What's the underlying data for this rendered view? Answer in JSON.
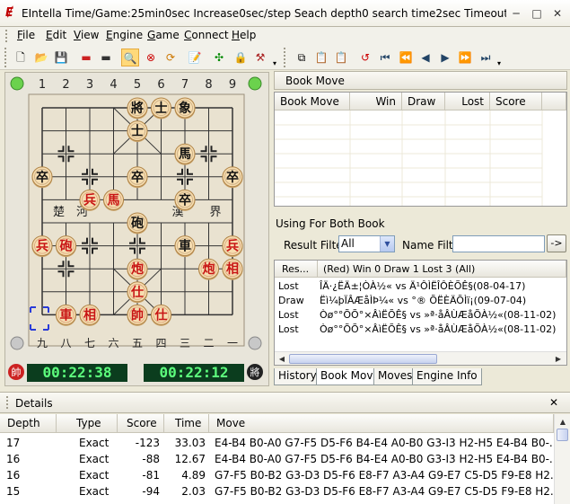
{
  "window": {
    "title": "EIntella Time/Game:25min0sec Increase0sec/step Seach depth0 search time2sec Timeout ...",
    "min": "─",
    "max": "□",
    "close": "✕"
  },
  "menu": [
    {
      "accel": "F",
      "rest": "ile"
    },
    {
      "accel": "E",
      "rest": "dit"
    },
    {
      "accel": "V",
      "rest": "iew"
    },
    {
      "accel": "E",
      "rest": "ngine"
    },
    {
      "accel": "G",
      "rest": "ame"
    },
    {
      "accel": "C",
      "rest": "onnect"
    },
    {
      "accel": "H",
      "rest": "elp"
    }
  ],
  "toolbar_icons": [
    "new-icon",
    "open-icon",
    "save-icon",
    "board-red-icon",
    "board-black-icon",
    "search-icon",
    "stop-icon",
    "refresh-icon",
    "edit-icon",
    "engine-icon",
    "lock-icon",
    "hammer-icon",
    "copy-icon",
    "paste-icon",
    "paste-board-icon",
    "undo-icon",
    "first-icon",
    "prev-fast-icon",
    "prev-icon",
    "next-icon",
    "next-fast-icon",
    "last-icon"
  ],
  "board": {
    "top_files": [
      "1",
      "2",
      "3",
      "4",
      "5",
      "6",
      "7",
      "8",
      "9"
    ],
    "bottom_files": [
      "九",
      "八",
      "七",
      "六",
      "五",
      "四",
      "三",
      "二",
      "一"
    ],
    "river_left": [
      "楚",
      "河"
    ],
    "river_right": [
      "漢",
      "界"
    ],
    "black_pieces": [
      {
        "c": "將",
        "f": 4,
        "r": 0
      },
      {
        "c": "士",
        "f": 5,
        "r": 0
      },
      {
        "c": "象",
        "f": 6,
        "r": 0
      },
      {
        "c": "士",
        "f": 4,
        "r": 1
      },
      {
        "c": "馬",
        "f": 6,
        "r": 2
      },
      {
        "c": "卒",
        "f": 0,
        "r": 3
      },
      {
        "c": "卒",
        "f": 4,
        "r": 3
      },
      {
        "c": "卒",
        "f": 8,
        "r": 3
      },
      {
        "c": "卒",
        "f": 6,
        "r": 4
      },
      {
        "c": "砲",
        "f": 4,
        "r": 5
      },
      {
        "c": "車",
        "f": 6,
        "r": 6
      }
    ],
    "red_pieces": [
      {
        "c": "兵",
        "f": 2,
        "r": 4
      },
      {
        "c": "馬",
        "f": 3,
        "r": 4
      },
      {
        "c": "兵",
        "f": 0,
        "r": 6
      },
      {
        "c": "砲",
        "f": 1,
        "r": 6
      },
      {
        "c": "兵",
        "f": 8,
        "r": 6
      },
      {
        "c": "炮",
        "f": 4,
        "r": 7
      },
      {
        "c": "炮",
        "f": 7,
        "r": 7
      },
      {
        "c": "相",
        "f": 8,
        "r": 7
      },
      {
        "c": "仕",
        "f": 4,
        "r": 8
      },
      {
        "c": "車",
        "f": 1,
        "r": 9
      },
      {
        "c": "相",
        "f": 2,
        "r": 9
      },
      {
        "c": "帥",
        "f": 4,
        "r": 9
      },
      {
        "c": "仕",
        "f": 5,
        "r": 9
      }
    ],
    "red_clock": "00:22:38",
    "black_clock": "00:22:12",
    "red_clock_badge": "帥",
    "black_clock_badge": "將"
  },
  "book_panel": {
    "title": "Book Move",
    "columns": [
      "Book Move",
      "Win",
      "Draw",
      "Lost",
      "Score"
    ],
    "using_label": "Using For Both Book",
    "result_filter_label": "Result Filter",
    "result_filter_value": "All",
    "name_filter_label": "Name Filter",
    "name_filter_value": "",
    "go_label": "->",
    "games_columns": [
      "Res...",
      "(Red) Win 0 Draw 1 Lost 3 (All)"
    ],
    "games": [
      {
        "res": "Lost",
        "desc": "ÎÄ·¿ËÄ±¦ÒÀ½« vs Ä¹ÔÌËÎÔÈÕÊ§(08-04-17)"
      },
      {
        "res": "Draw",
        "desc": "Ëì¼þÏÂÆåÌÞ¼« vs °® ÕËÈÄÕÌï¡(09-07-04)"
      },
      {
        "res": "Lost",
        "desc": "Òø°°ÕÕ°×ÂìËÕÊ§ vs »ª·åÂÙÆåÕÀ½«(08-11-02)"
      },
      {
        "res": "Lost",
        "desc": "Òø°°ÕÕ°×ÂìËÕÊ§ vs »ª·åÂÙÆåÕÀ½«(08-11-02)"
      }
    ],
    "tabs": [
      "History",
      "Book Move",
      "Moves",
      "Engine Info"
    ],
    "active_tab": "Book Move"
  },
  "details": {
    "title": "Details",
    "close": "✕",
    "columns": [
      "Depth",
      "Type",
      "Score",
      "Time",
      "Move"
    ],
    "rows": [
      {
        "depth": "17",
        "type": "Exact",
        "score": "-123",
        "time": "33.03",
        "move": "E4-B4 B0-A0 G7-F5 D5-F6 B4-E4 A0-B0 G3-I3 H2-H5 E4-B4 B0-..."
      },
      {
        "depth": "16",
        "type": "Exact",
        "score": "-88",
        "time": "12.67",
        "move": "E4-B4 B0-A0 G7-F5 D5-F6 B4-E4 A0-B0 G3-I3 H2-H5 E4-B4 B0-..."
      },
      {
        "depth": "16",
        "type": "Exact",
        "score": "-81",
        "time": "4.89",
        "move": "G7-F5 B0-B2 G3-D3 D5-F6 E8-F7 A3-A4 G9-E7 C5-D5 F9-E8 H2..."
      },
      {
        "depth": "15",
        "type": "Exact",
        "score": "-94",
        "time": "2.03",
        "move": "G7-F5 B0-B2 G3-D3 D5-F6 E8-F7 A3-A4 G9-E7 C5-D5 F9-E8 H2..."
      }
    ]
  }
}
